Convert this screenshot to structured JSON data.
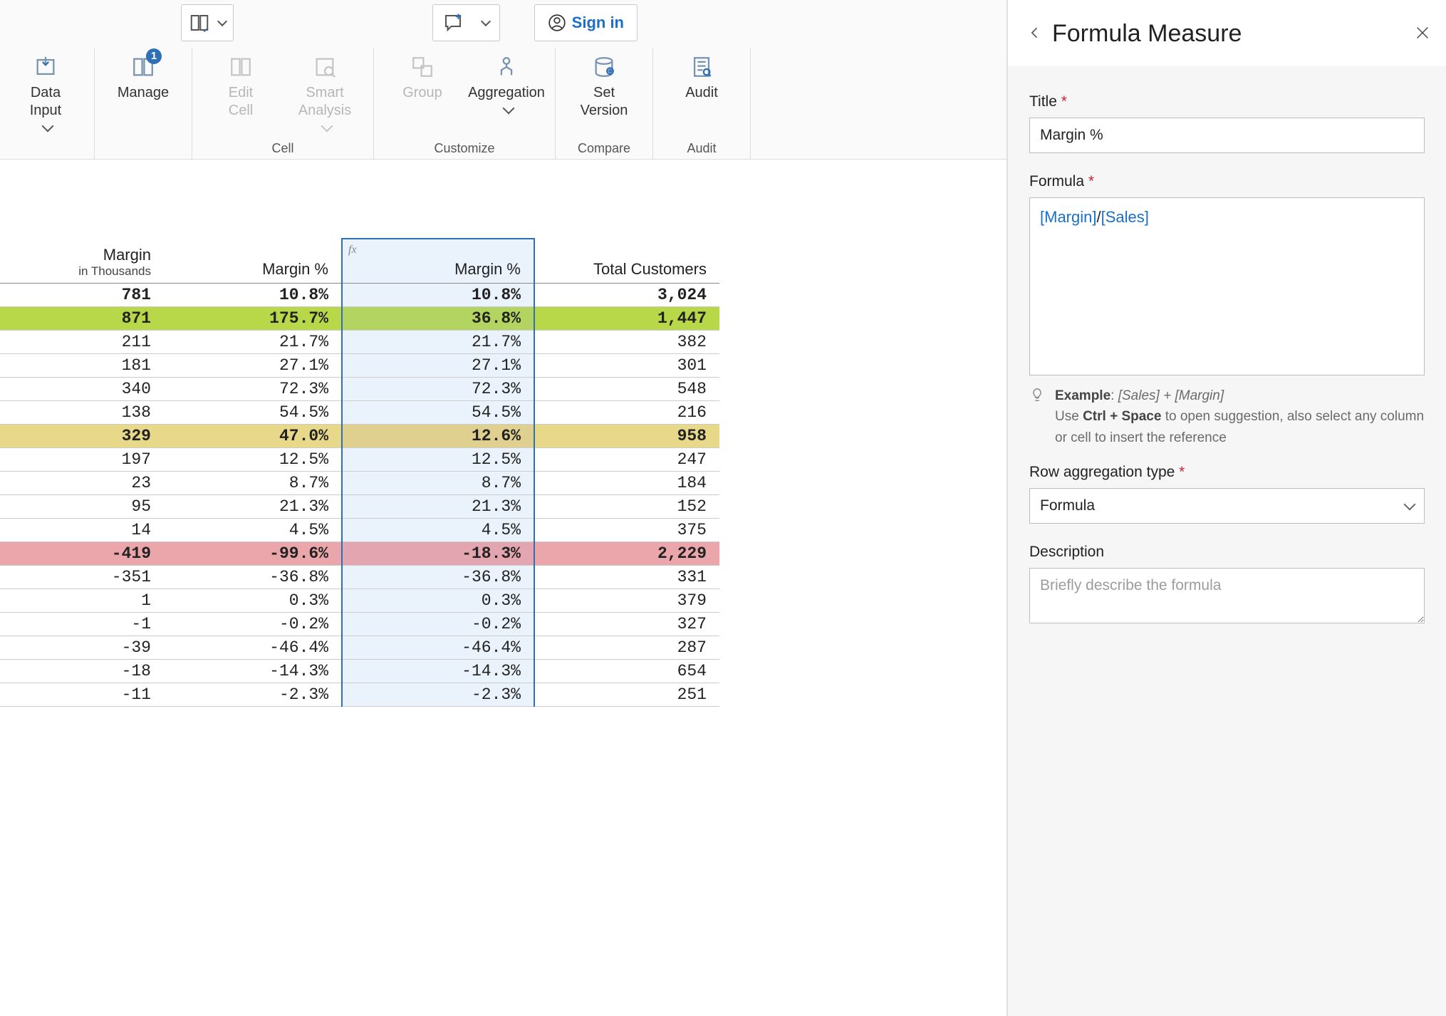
{
  "ribbon": {
    "data_input_label": "Data\nInput",
    "manage_label": "Manage",
    "manage_badge": "1",
    "edit_cell_label": "Edit\nCell",
    "smart_analysis_label": "Smart\nAnalysis",
    "group_label": "Group",
    "aggregation_label": "Aggregation",
    "set_version_label": "Set\nVersion",
    "audit_label": "Audit",
    "section_cell": "Cell",
    "section_customize": "Customize",
    "section_compare": "Compare",
    "section_audit": "Audit",
    "signin_label": "Sign in"
  },
  "table": {
    "headers": {
      "margin": "Margin",
      "margin_sub": "in Thousands",
      "margin_pct": "Margin %",
      "margin_pct2": "Margin %",
      "fx_indicator": "fx",
      "total_customers": "Total Customers"
    },
    "rows": [
      {
        "style": "bold",
        "margin": "781",
        "mpct": "10.8%",
        "mpct2": "10.8%",
        "tcust": "3,024"
      },
      {
        "style": "bold green",
        "margin": "871",
        "mpct": "175.7%",
        "mpct2": "36.8%",
        "tcust": "1,447"
      },
      {
        "style": "",
        "margin": "211",
        "mpct": "21.7%",
        "mpct2": "21.7%",
        "tcust": "382"
      },
      {
        "style": "",
        "margin": "181",
        "mpct": "27.1%",
        "mpct2": "27.1%",
        "tcust": "301"
      },
      {
        "style": "",
        "margin": "340",
        "mpct": "72.3%",
        "mpct2": "72.3%",
        "tcust": "548"
      },
      {
        "style": "",
        "margin": "138",
        "mpct": "54.5%",
        "mpct2": "54.5%",
        "tcust": "216"
      },
      {
        "style": "bold yellow",
        "margin": "329",
        "mpct": "47.0%",
        "mpct2": "12.6%",
        "tcust": "958"
      },
      {
        "style": "",
        "margin": "197",
        "mpct": "12.5%",
        "mpct2": "12.5%",
        "tcust": "247"
      },
      {
        "style": "",
        "margin": "23",
        "mpct": "8.7%",
        "mpct2": "8.7%",
        "tcust": "184"
      },
      {
        "style": "",
        "margin": "95",
        "mpct": "21.3%",
        "mpct2": "21.3%",
        "tcust": "152"
      },
      {
        "style": "",
        "margin": "14",
        "mpct": "4.5%",
        "mpct2": "4.5%",
        "tcust": "375"
      },
      {
        "style": "bold pink",
        "margin": "-419",
        "mpct": "-99.6%",
        "mpct2": "-18.3%",
        "tcust": "2,229"
      },
      {
        "style": "",
        "margin": "-351",
        "mpct": "-36.8%",
        "mpct2": "-36.8%",
        "tcust": "331"
      },
      {
        "style": "",
        "margin": "1",
        "mpct": "0.3%",
        "mpct2": "0.3%",
        "tcust": "379"
      },
      {
        "style": "",
        "margin": "-1",
        "mpct": "-0.2%",
        "mpct2": "-0.2%",
        "tcust": "327"
      },
      {
        "style": "",
        "margin": "-39",
        "mpct": "-46.4%",
        "mpct2": "-46.4%",
        "tcust": "287"
      },
      {
        "style": "",
        "margin": "-18",
        "mpct": "-14.3%",
        "mpct2": "-14.3%",
        "tcust": "654"
      },
      {
        "style": "",
        "margin": "-11",
        "mpct": "-2.3%",
        "mpct2": "-2.3%",
        "tcust": "251"
      }
    ]
  },
  "panel": {
    "heading": "Formula Measure",
    "title_label": "Title",
    "title_value": "Margin %",
    "formula_label": "Formula",
    "formula_tokens": [
      "[Margin]",
      "/",
      "[Sales]"
    ],
    "example_prefix": "Example",
    "example_text": "[Sales] + [Margin]",
    "help_line1_a": "Use ",
    "help_line1_kbd": "Ctrl + Space",
    "help_line1_b": " to open suggestion, also select any column or cell to insert the reference",
    "row_agg_label": "Row aggregation type",
    "row_agg_value": "Formula",
    "description_label": "Description",
    "description_placeholder": "Briefly describe the formula"
  }
}
